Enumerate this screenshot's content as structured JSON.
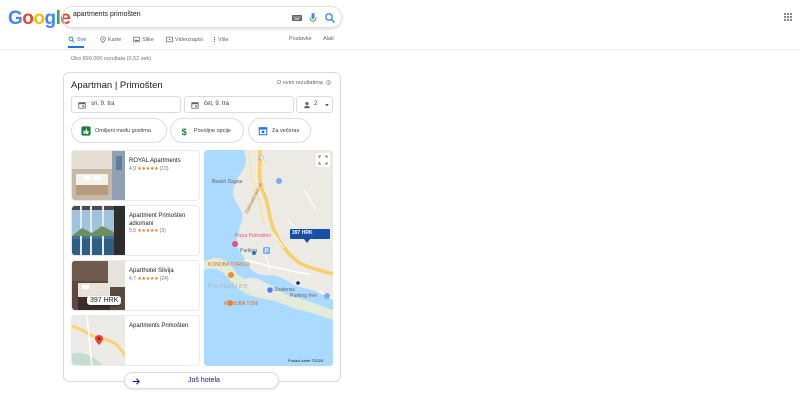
{
  "logo": {
    "letters": [
      "G",
      "o",
      "o",
      "g",
      "l",
      "e"
    ],
    "colors": [
      "#4285f4",
      "#ea4335",
      "#fbbc05",
      "#4285f4",
      "#34a853",
      "#ea4335"
    ]
  },
  "search": {
    "query": "apartments primošten"
  },
  "tabs": [
    {
      "label": "Sve",
      "icon": "search-icon",
      "active": true
    },
    {
      "label": "Karte",
      "icon": "map-pin-icon"
    },
    {
      "label": "Slike",
      "icon": "image-icon"
    },
    {
      "label": "Videozapisi",
      "icon": "video-icon"
    },
    {
      "label": "Više",
      "icon": "more-vertical-icon"
    }
  ],
  "tools": {
    "settings": "Postavke",
    "tools": "Alati"
  },
  "stats": "Oko 890.000 rezultata (0,52 sek)",
  "card": {
    "title": "Apartman | Primošten",
    "about": "O ovim rezultatima",
    "checkin": "sri, 9. tra",
    "checkout": "čet, 9. tra",
    "guests": "2",
    "chips": [
      "Omiljeni među gostima",
      "Povoljne opcije",
      "Za večeras"
    ],
    "hotels": [
      {
        "name": "ROYAL Apartments",
        "rating": "4,9",
        "stars": "★★★★★",
        "reviews": "(13)"
      },
      {
        "name": "Apartment Primošten adiomani",
        "rating": "5,0",
        "stars": "★★★★★",
        "reviews": "(3)"
      },
      {
        "name": "Aparthotel Silvija",
        "rating": "4,7",
        "stars": "★★★★★",
        "reviews": "(24)",
        "price": "397 HRK"
      },
      {
        "name": "Apartments Primošten"
      }
    ],
    "map": {
      "labels": {
        "beach": "Beach Dagna",
        "road": "Dalmatinska ul.",
        "pizza": "Pizza Primošten",
        "parking": "Parking",
        "konoba1": "KONOBA TORKUL",
        "town": "Primošten",
        "studenac": "Studenac",
        "konoba2": "KONOBA TONI",
        "parking2": "Parking free",
        "copyright": "Podaci karte ©2020."
      },
      "price": "397 HRK"
    },
    "more": "Još hotela"
  }
}
